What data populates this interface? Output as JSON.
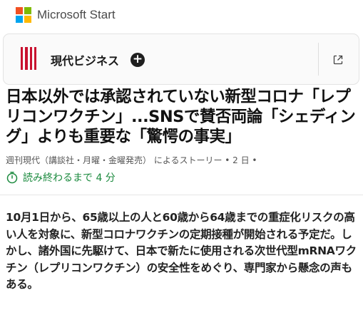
{
  "header": {
    "title": "Microsoft Start",
    "logo_colors": [
      "#f25022",
      "#7fba00",
      "#00a4ef",
      "#ffb900"
    ]
  },
  "source": {
    "name": "現代ビジネス",
    "follow_label": "+",
    "brand_color": "#c8102e"
  },
  "article": {
    "headline": "日本以外では承認されていない新型コロナ「レプリコンワクチン」...SNSで賛否両論「シェディング」よりも重要な「驚愕の事実」",
    "byline": "週刊現代（講談社・月曜・金曜発売） によるストーリー • 2 日 •",
    "read_time": "読み終わるまで 4 分",
    "read_time_color": "#1b8a3e",
    "body": "10月1日から、65歳以上の人と60歳から64歳までの重症化リスクの高い人を対象に、新型コロナワクチンの定期接種が開始される予定だ。しかし、諸外国に先駆けて、日本で新たに使用される次世代型mRNAワクチン（レプリコンワクチン）の安全性をめぐり、専門家から懸念の声もある。"
  }
}
